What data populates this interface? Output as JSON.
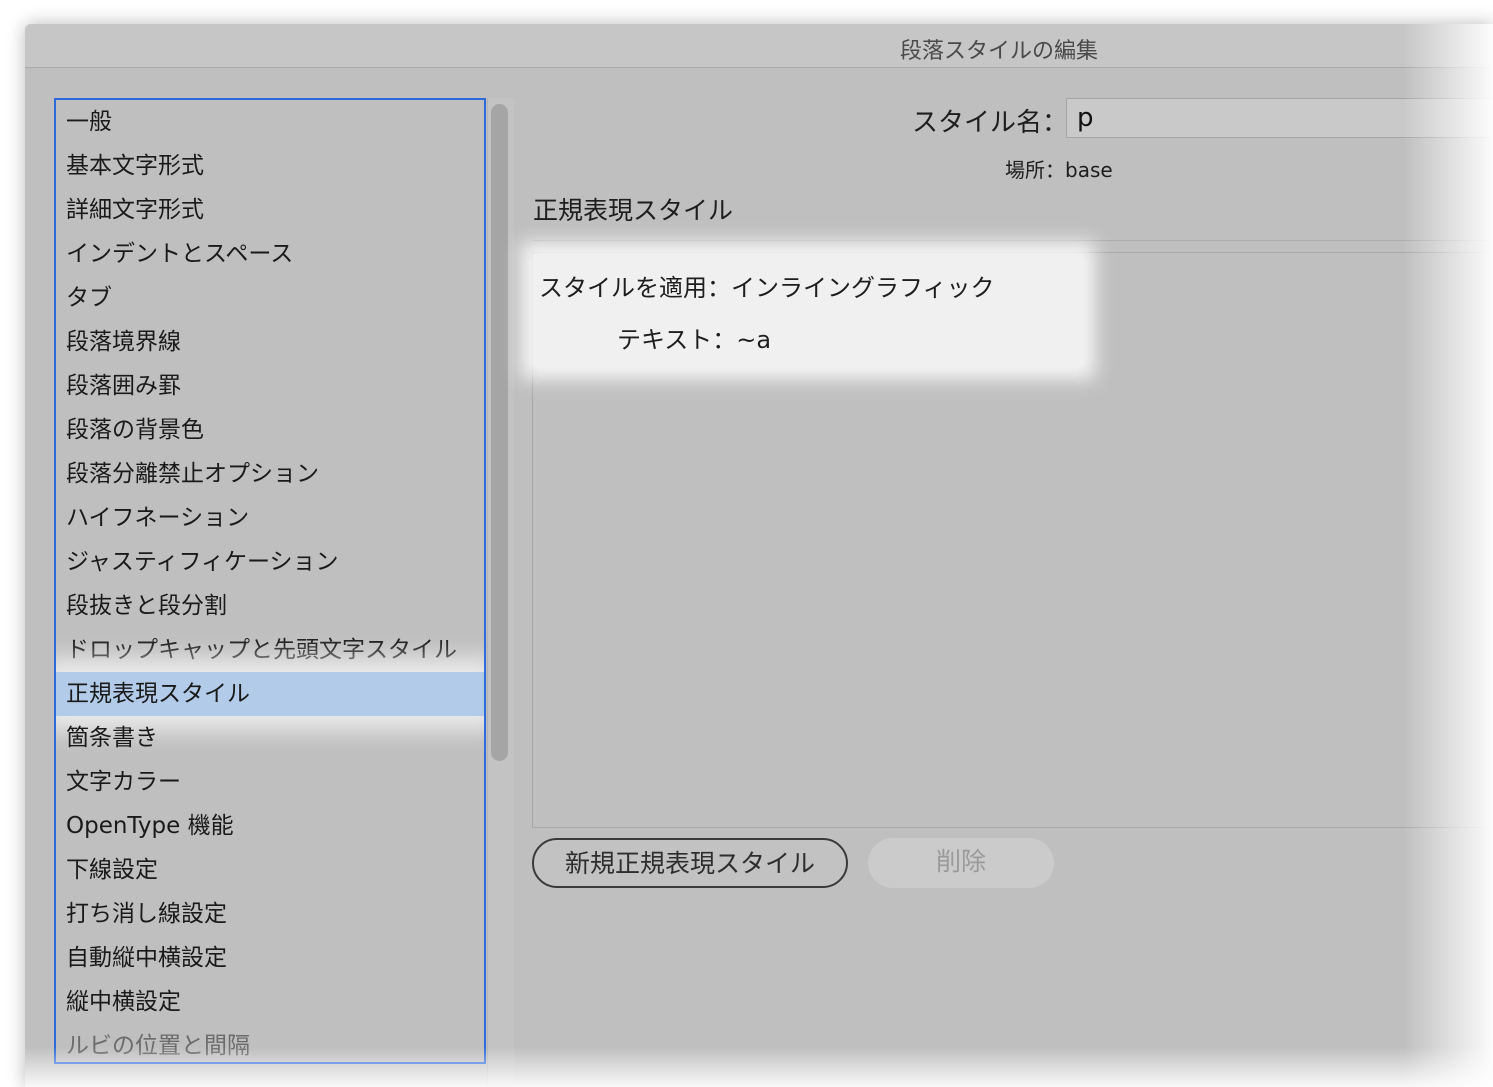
{
  "window": {
    "title": "段落スタイルの編集"
  },
  "sidebar": {
    "items": [
      {
        "label": "一般"
      },
      {
        "label": "基本文字形式"
      },
      {
        "label": "詳細文字形式"
      },
      {
        "label": "インデントとスペース"
      },
      {
        "label": "タブ"
      },
      {
        "label": "段落境界線"
      },
      {
        "label": "段落囲み罫"
      },
      {
        "label": "段落の背景色"
      },
      {
        "label": "段落分離禁止オプション"
      },
      {
        "label": "ハイフネーション"
      },
      {
        "label": "ジャスティフィケーション"
      },
      {
        "label": "段抜きと段分割"
      },
      {
        "label": "ドロップキャップと先頭文字スタイル"
      },
      {
        "label": "正規表現スタイル",
        "selected": true
      },
      {
        "label": "箇条書き"
      },
      {
        "label": "文字カラー"
      },
      {
        "label": "OpenType 機能"
      },
      {
        "label": "下線設定"
      },
      {
        "label": "打ち消し線設定"
      },
      {
        "label": "自動縦中横設定"
      },
      {
        "label": "縦中横設定"
      },
      {
        "label": "ルビの位置と間隔"
      }
    ]
  },
  "header": {
    "style_name_label": "スタイル名：",
    "style_name_value": "p",
    "location_text": "場所：base"
  },
  "main": {
    "section_title": "正規表現スタイル",
    "rule": {
      "apply_style_text": "スタイルを適用：インライングラフィック",
      "text_text": "テキスト：~a"
    },
    "buttons": {
      "new_label": "新規正規表現スタイル",
      "delete_label": "削除"
    }
  },
  "colors": {
    "selection": "#b2cbe9",
    "focus_ring": "#2f6bd8",
    "panel_bg": "#bfbfbf"
  }
}
